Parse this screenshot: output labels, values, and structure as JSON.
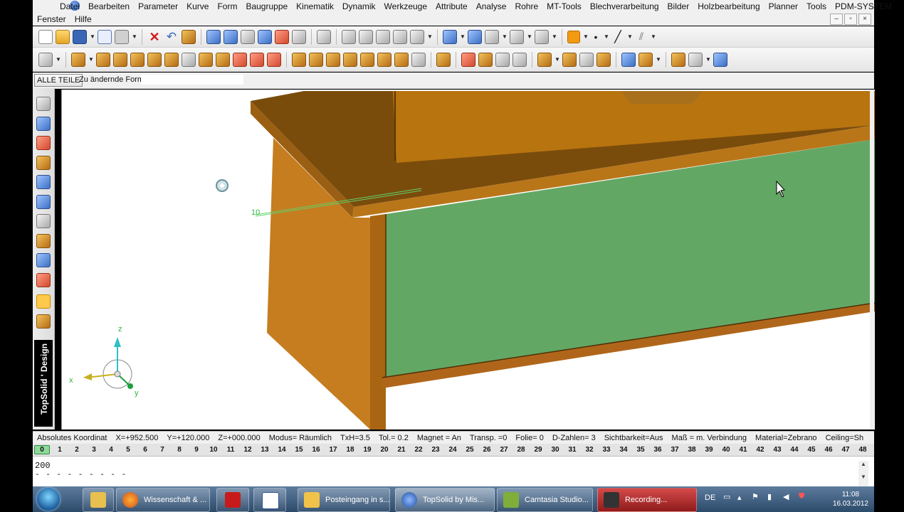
{
  "menu": {
    "row1": [
      "Datei",
      "Bearbeiten",
      "Parameter",
      "Kurve",
      "Form",
      "Baugruppe",
      "Kinematik",
      "Dynamik",
      "Werkzeuge",
      "Attribute",
      "Analyse",
      "Rohre",
      "MT-Tools",
      "Blechverarbeitung",
      "Bilder",
      "Holzbearbeitung",
      "Planner",
      "Tools",
      "PDM-SYSTEM"
    ],
    "row2": [
      "Fenster",
      "Hilfe"
    ],
    "window_buttons": [
      "–",
      "▫",
      "×"
    ]
  },
  "context": {
    "all_parts_button": "ALLE TEILE",
    "label": "Zu ändernde Form:",
    "input_value": ""
  },
  "viewport": {
    "dimension_label": "10",
    "axis_labels": {
      "z": "z",
      "x": "x",
      "y": "y"
    },
    "colors": {
      "wood_top": "#7a4c0c",
      "wood_side": "#c57d20",
      "panel": "#63a765"
    }
  },
  "branding": "TopSolid ' Design",
  "status": [
    "Absolutes Koordinat",
    "X=+952.500",
    "Y=+120.000",
    "Z=+000.000",
    "Modus= Räumlich",
    "TxH=3.5",
    "Tol.=  0.2",
    "Magnet = An",
    "Transp. =0",
    "Folie=  0",
    "D-Zahlen= 3",
    "Sichtbarkeit=Aus",
    "Maß = m. Verbindung",
    "Material=Zebrano",
    "Ceiling=Sh"
  ],
  "layers": [
    "0",
    "1",
    "2",
    "3",
    "4",
    "5",
    "6",
    "7",
    "8",
    "9",
    "10",
    "11",
    "12",
    "13",
    "14",
    "15",
    "16",
    "17",
    "18",
    "19",
    "20",
    "21",
    "22",
    "23",
    "24",
    "25",
    "26",
    "27",
    "28",
    "29",
    "30",
    "31",
    "32",
    "33",
    "34",
    "35",
    "36",
    "37",
    "38",
    "39",
    "40",
    "41",
    "42",
    "43",
    "44",
    "45",
    "46",
    "47",
    "48"
  ],
  "command": {
    "value": "200",
    "dashes": "- - - - - - - - -"
  },
  "taskbar": {
    "items": [
      "Wissenschaft & ...",
      "",
      "",
      "Posteingang in s...",
      "TopSolid by Mis...",
      "Camtasia Studio...",
      "Recording..."
    ],
    "language": "DE",
    "time": "11:08",
    "date": "16.03.2012"
  }
}
